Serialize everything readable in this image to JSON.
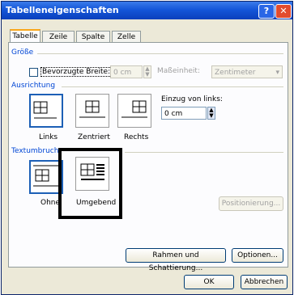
{
  "window": {
    "title": "Tabelleneigenschaften",
    "help_label": "?",
    "close_label": "✕"
  },
  "tabs": [
    "Tabelle",
    "Zeile",
    "Spalte",
    "Zelle"
  ],
  "groesse": {
    "heading": "Größe",
    "pref_width_label": "Bevorzugte Breite:",
    "pref_width_value": "0 cm",
    "unit_label": "Maßeinheit:",
    "unit_value": "Zentimeter"
  },
  "ausrichtung": {
    "heading": "Ausrichtung",
    "options": [
      "Links",
      "Zentriert",
      "Rechts"
    ],
    "indent_label": "Einzug von links:",
    "indent_value": "0 cm"
  },
  "textumbruch": {
    "heading": "Textumbruch",
    "options": [
      "Ohne",
      "Umgebend"
    ],
    "positioning_label": "Positionierung..."
  },
  "buttons": {
    "borders_label": "Rahmen und Schattierung...",
    "options_label": "Optionen...",
    "ok_label": "OK",
    "cancel_label": "Abbrechen"
  }
}
